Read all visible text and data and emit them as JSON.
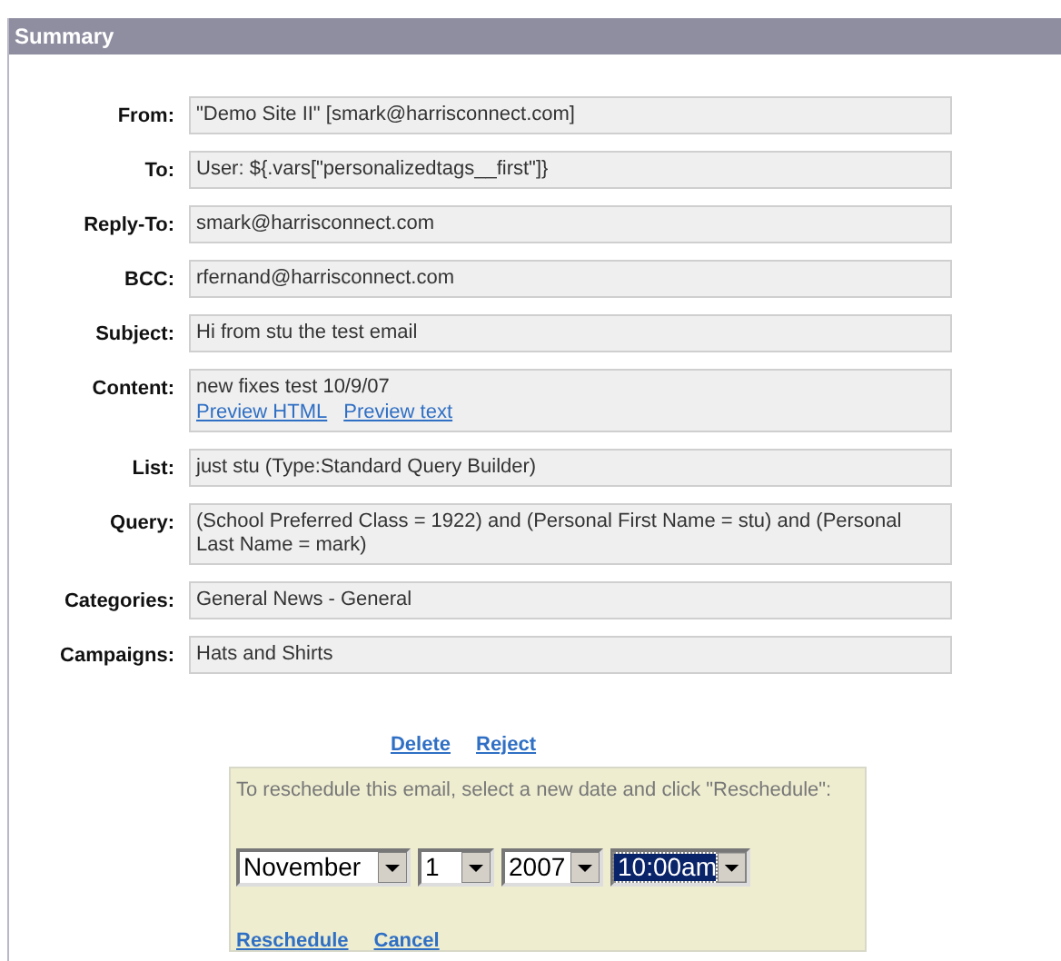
{
  "panel": {
    "title": "Summary"
  },
  "fields": [
    {
      "label": "From:",
      "lines": [
        "\"Demo Site II\" [smark@harrisconnect.com]"
      ]
    },
    {
      "label": "To:",
      "lines": [
        "User: ${.vars[\"personalizedtags__first\"]}"
      ]
    },
    {
      "label": "Reply-To:",
      "lines": [
        "smark@harrisconnect.com"
      ]
    },
    {
      "label": "BCC:",
      "lines": [
        "rfernand@harrisconnect.com"
      ]
    },
    {
      "label": "Subject:",
      "lines": [
        "Hi from stu the test email"
      ]
    },
    {
      "label": "Content:",
      "lines": [
        "new  fixes test 10/9/07"
      ],
      "links": [
        "Preview HTML",
        "Preview text"
      ]
    },
    {
      "label": "List:",
      "lines": [
        "just stu (Type:Standard Query Builder)"
      ]
    },
    {
      "label": "Query:",
      "lines": [
        "(School Preferred Class = 1922) and (Personal First Name = stu) and (Personal Last Name = mark)"
      ]
    },
    {
      "label": "Categories:",
      "lines": [
        "General News - General"
      ]
    },
    {
      "label": "Campaigns:",
      "lines": [
        "Hats and Shirts"
      ]
    }
  ],
  "actions": [
    "Delete",
    "Reject"
  ],
  "reschedule": {
    "instruction": "To reschedule this email, select a new date and click \"Reschedule\":",
    "selects": [
      {
        "value": "November",
        "focused": false
      },
      {
        "value": "1",
        "focused": false
      },
      {
        "value": "2007",
        "focused": false
      },
      {
        "value": "10:00am",
        "focused": true
      }
    ],
    "links": [
      "Reschedule",
      "Cancel"
    ]
  }
}
